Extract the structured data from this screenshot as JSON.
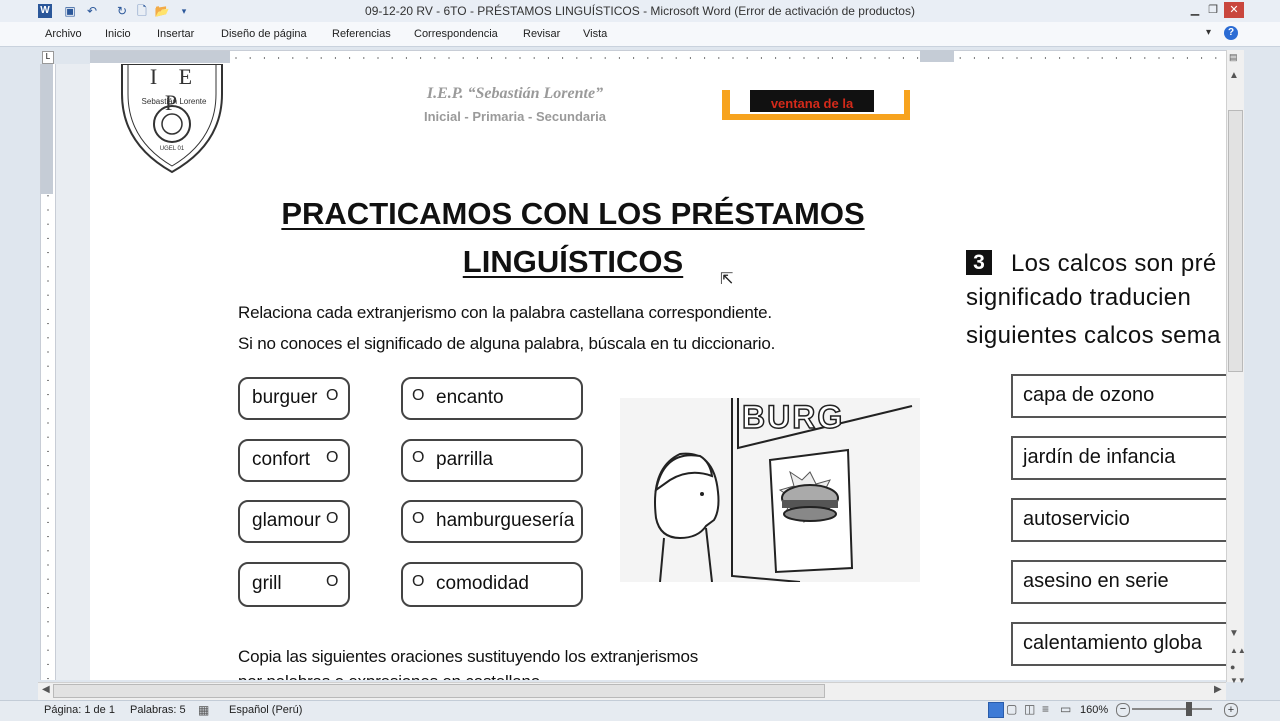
{
  "window": {
    "title": "09-12-20 RV - 6TO - PRÉSTAMOS LINGUÍSTICOS  -  Microsoft Word (Error de activación de productos)"
  },
  "ribbon": {
    "tabs": [
      "Archivo",
      "Inicio",
      "Insertar",
      "Diseño de página",
      "Referencias",
      "Correspondencia",
      "Revisar",
      "Vista"
    ]
  },
  "document": {
    "school": {
      "logo_text": "I E P",
      "logo_subtitle": "Sebastián Lorente",
      "logo_footer": "UGEL 01",
      "name": "I.E.P. “Sebastián Lorente”",
      "levels": "Inicial - Primaria -  Secundaria"
    },
    "banner_text": "ventana de la",
    "heading_line1": "PRACTICAMOS CON LOS PRÉSTAMOS",
    "heading_line2": "LINGUÍSTICOS",
    "instructions_1": "Relaciona cada extranjerismo con la palabra castellana correspondiente.",
    "instructions_2": "Si no conoces el significado de alguna palabra, búscala en tu diccionario.",
    "left_words": [
      "burguer",
      "confort",
      "glamour",
      "grill"
    ],
    "right_words": [
      "encanto",
      "parrilla",
      "hamburguesería",
      "comodidad"
    ],
    "circle_marker": "O",
    "copy_instructions": "Copia las siguientes oraciones sustituyendo los extranjerismos",
    "copy_instructions_2": "por palabras o expresiones en castellano",
    "shop_sign": "BURG",
    "section3": {
      "number": "3",
      "line1": "Los calcos son pré",
      "line2": "significado  traducien",
      "line3": "siguientes calcos sema"
    },
    "calcos": [
      "capa de ozono",
      "jardín de infancia",
      "autoservicio",
      "asesino en serie",
      "calentamiento globa"
    ]
  },
  "status": {
    "page": "Página: 1 de 1",
    "words": "Palabras: 5",
    "language": "Español (Perú)",
    "zoom": "160%"
  }
}
